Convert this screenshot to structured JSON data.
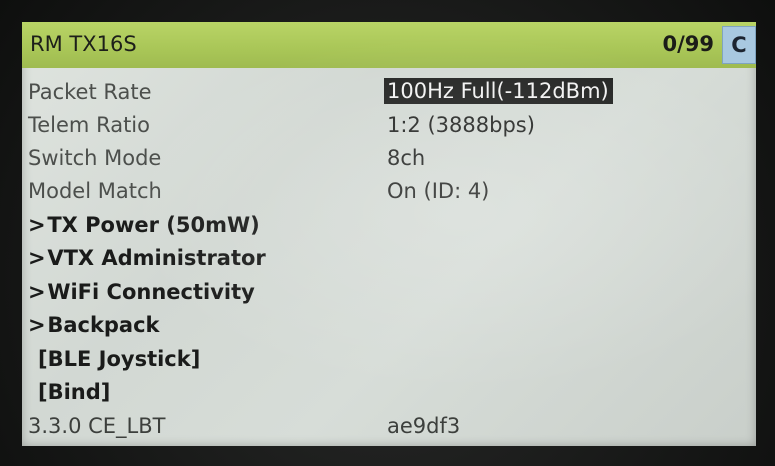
{
  "header": {
    "title": "RM TX16S",
    "counter": "0/99",
    "cancel_label": "C"
  },
  "menu": {
    "items": [
      {
        "label": "Packet Rate",
        "value": "100Hz Full(-112dBm)",
        "selected": true
      },
      {
        "label": "Telem Ratio",
        "value": "1:2 (3888bps)"
      },
      {
        "label": "Switch Mode",
        "value": "8ch"
      },
      {
        "label": "Model Match",
        "value": "On (ID: 4)"
      },
      {
        "label": "TX Power (50mW)",
        "prefix": ">"
      },
      {
        "label": "VTX Administrator",
        "prefix": ">"
      },
      {
        "label": "WiFi Connectivity",
        "prefix": ">"
      },
      {
        "label": "Backpack",
        "prefix": ">"
      },
      {
        "label": "[BLE Joystick]"
      },
      {
        "label": "[Bind]"
      }
    ]
  },
  "footer": {
    "version": "3.3.0 CE_LBT",
    "hash": "ae9df3"
  },
  "colors": {
    "title_bar": "#a9c657",
    "screen_bg": "#d7ddd8",
    "selected_bg": "#232423",
    "cancel_bg": "#a8c8e0"
  }
}
